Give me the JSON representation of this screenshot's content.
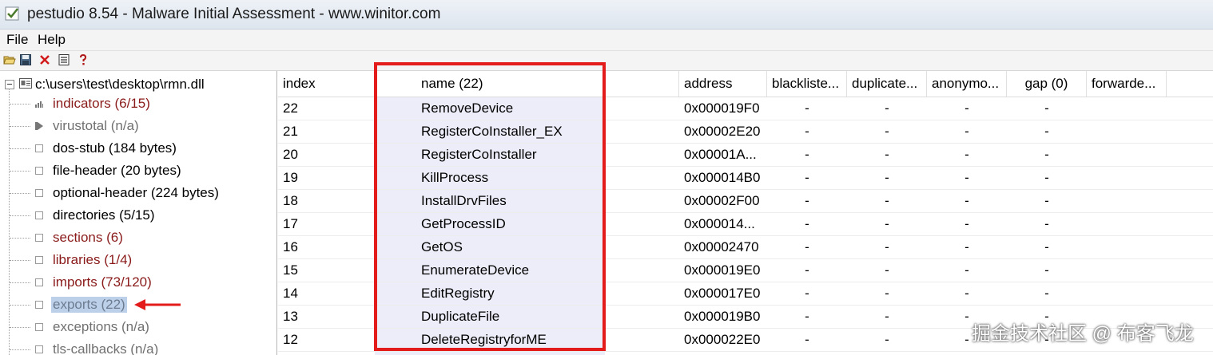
{
  "window": {
    "title": "pestudio 8.54 - Malware Initial Assessment - www.winitor.com"
  },
  "menu": [
    "File",
    "Help"
  ],
  "toolbar": [
    "open-icon",
    "save-icon",
    "delete-icon",
    "list-icon",
    "help-icon"
  ],
  "tree": {
    "root": "c:\\users\\test\\desktop\\rmn.dll",
    "items": [
      {
        "label": "indicators (6/15)",
        "icon": "indicators-icon",
        "color": "#8a1a1a"
      },
      {
        "label": "virustotal (n/a)",
        "icon": "virustotal-icon",
        "color": "#707070"
      },
      {
        "label": "dos-stub (184 bytes)",
        "icon": "box-icon",
        "color": "#000000"
      },
      {
        "label": "file-header (20 bytes)",
        "icon": "box-icon",
        "color": "#000000"
      },
      {
        "label": "optional-header (224 bytes)",
        "icon": "box-icon",
        "color": "#000000"
      },
      {
        "label": "directories (5/15)",
        "icon": "box-icon",
        "color": "#000000"
      },
      {
        "label": "sections (6)",
        "icon": "box-icon",
        "color": "#8a1a1a"
      },
      {
        "label": "libraries (1/4)",
        "icon": "box-icon",
        "color": "#8a1a1a"
      },
      {
        "label": "imports (73/120)",
        "icon": "box-icon",
        "color": "#8a1a1a"
      },
      {
        "label": "exports (22)",
        "icon": "box-icon",
        "color": "#6d7c8f",
        "selected": true
      },
      {
        "label": "exceptions (n/a)",
        "icon": "box-icon",
        "color": "#707070"
      },
      {
        "label": "tls-callbacks (n/a)",
        "icon": "box-icon",
        "color": "#707070"
      }
    ]
  },
  "table": {
    "columns": [
      "index",
      "name (22)",
      "address",
      "blackliste...",
      "duplicate...",
      "anonymo...",
      "gap (0)",
      "forwarde..."
    ],
    "rows": [
      [
        "22",
        "RemoveDevice",
        "0x000019F0",
        "-",
        "-",
        "-",
        "-"
      ],
      [
        "21",
        "RegisterCoInstaller_EX",
        "0x00002E20",
        "-",
        "-",
        "-",
        "-"
      ],
      [
        "20",
        "RegisterCoInstaller",
        "0x00001A...",
        "-",
        "-",
        "-",
        "-"
      ],
      [
        "19",
        "KillProcess",
        "0x000014B0",
        "-",
        "-",
        "-",
        "-"
      ],
      [
        "18",
        "InstallDrvFiles",
        "0x00002F00",
        "-",
        "-",
        "-",
        "-"
      ],
      [
        "17",
        "GetProcessID",
        "0x000014...",
        "-",
        "-",
        "-",
        "-"
      ],
      [
        "16",
        "GetOS",
        "0x00002470",
        "-",
        "-",
        "-",
        "-"
      ],
      [
        "15",
        "EnumerateDevice",
        "0x000019E0",
        "-",
        "-",
        "-",
        "-"
      ],
      [
        "14",
        "EditRegistry",
        "0x000017E0",
        "-",
        "-",
        "-",
        "-"
      ],
      [
        "13",
        "DuplicateFile",
        "0x000019B0",
        "-",
        "-",
        "-",
        "-"
      ],
      [
        "12",
        "DeleteRegistryforME",
        "0x000022E0",
        "-",
        "-",
        "-",
        "-"
      ]
    ]
  },
  "colors": {
    "annotation": "#e31b1b",
    "name_column_shade": "#ecedf8",
    "selection": "#bcd0ea"
  },
  "watermark": "掘金技术社区 @ 布客飞龙"
}
